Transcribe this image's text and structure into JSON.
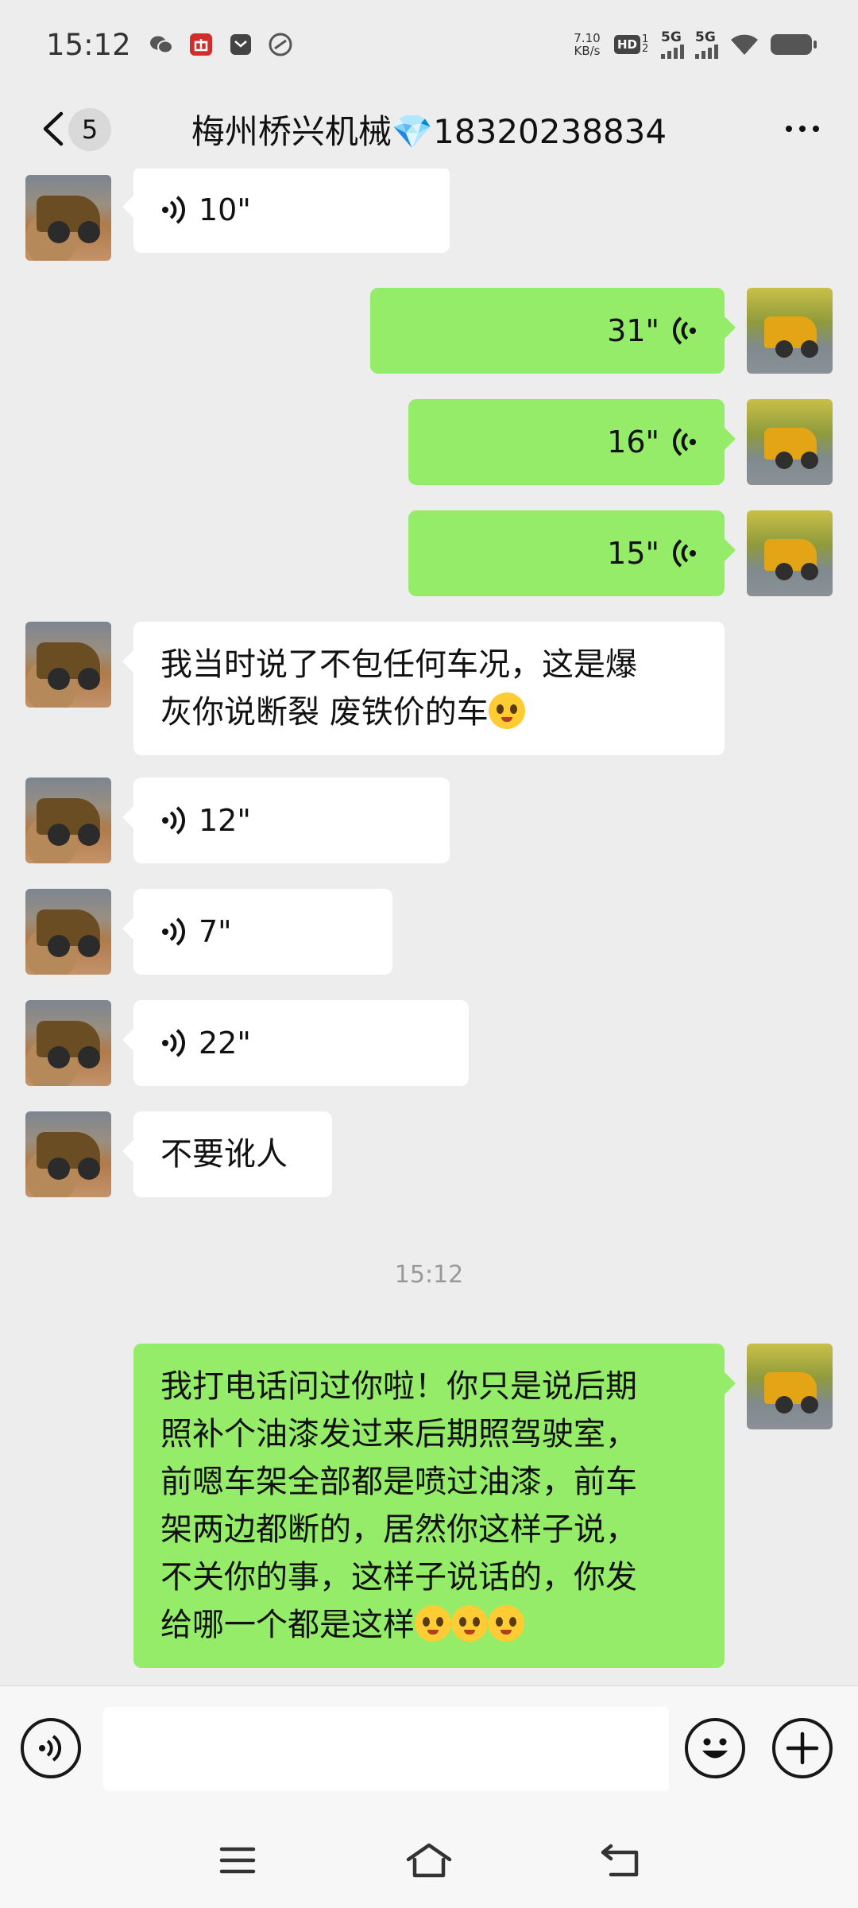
{
  "status_bar": {
    "time": "15:12",
    "net_speed_value": "7.10",
    "net_speed_unit": "KB/s",
    "hd_label": "HD",
    "hd_sub": "1 2",
    "sim1_label": "5G",
    "sim2_label": "5G",
    "app_icons": [
      "wechat-icon",
      "gift-app-icon",
      "mail-app-icon",
      "link-app-icon"
    ]
  },
  "header": {
    "unread_count": "5",
    "title": "梅州桥兴机械💎18320238834"
  },
  "messages": [
    {
      "side": "in",
      "type": "voice",
      "duration": "10\""
    },
    {
      "side": "out",
      "type": "voice",
      "duration": "31\""
    },
    {
      "side": "out",
      "type": "voice",
      "duration": "16\""
    },
    {
      "side": "out",
      "type": "voice",
      "duration": "15\""
    },
    {
      "side": "in",
      "type": "text",
      "line1": "我当时说了不包任何车况，这是爆",
      "line2": "灰你说断裂 废铁价的车"
    },
    {
      "side": "in",
      "type": "voice",
      "duration": "12\""
    },
    {
      "side": "in",
      "type": "voice",
      "duration": "7\""
    },
    {
      "side": "in",
      "type": "voice",
      "duration": "22\""
    },
    {
      "side": "in",
      "type": "text",
      "line1": "不要讹人"
    },
    {
      "side": "out",
      "type": "text",
      "lines": [
        "我打电话问过你啦！你只是说后期",
        "照补个油漆发过来后期照驾驶室，",
        "前嗯车架全部都是喷过油漆，前车",
        "架两边都断的，居然你这样子说，",
        "不关你的事，这样子说话的，你发",
        "给哪一个都是这样"
      ]
    }
  ],
  "time_divider": "15:12",
  "colors": {
    "background": "#ededed",
    "outgoing_bubble": "#95ec69",
    "incoming_bubble": "#ffffff"
  },
  "input_bar": {
    "text_value": ""
  }
}
